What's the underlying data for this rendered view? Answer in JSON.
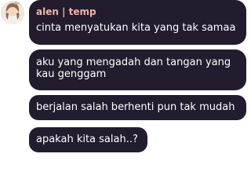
{
  "author": {
    "name": "alen | temp",
    "color": "#efb6a8"
  },
  "messages": [
    {
      "text": "cinta menyatukan kita yang tak samaa"
    },
    {
      "line1": "aku yang mengadah dan tangan yang",
      "line2": "kau genggam"
    },
    {
      "text": "berjalan salah berhenti pun tak mudah"
    },
    {
      "text": "apakah kita salah..?"
    }
  ],
  "colors": {
    "bubble": "#221c2e",
    "text": "#ffffff",
    "background": "#ffffff"
  }
}
